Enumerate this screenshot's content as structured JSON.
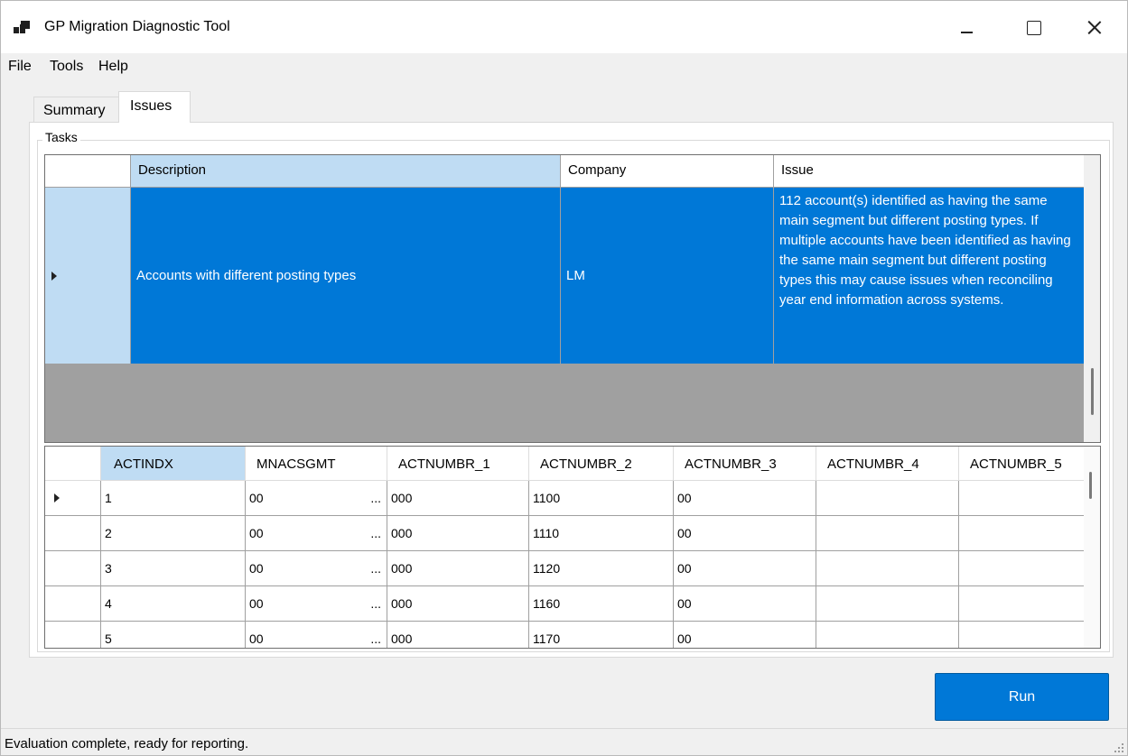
{
  "window": {
    "title": "GP Migration Diagnostic Tool"
  },
  "menu": {
    "file": "File",
    "tools": "Tools",
    "help": "Help"
  },
  "tabs": {
    "summary": "Summary",
    "issues": "Issues"
  },
  "group": {
    "label": "Tasks"
  },
  "tasks_grid": {
    "columns": [
      "Description",
      "Company",
      "Issue"
    ],
    "rows": [
      {
        "description": "Accounts with different posting types",
        "company": "LM",
        "issue": "112 account(s) identified as having the same main segment but different posting types. If multiple accounts have been identified as having the same main segment but different posting types this may cause issues when reconciling year end information across systems."
      }
    ]
  },
  "detail_grid": {
    "columns": [
      "ACTINDX",
      "MNACSGMT",
      "ACTNUMBR_1",
      "ACTNUMBR_2",
      "ACTNUMBR_3",
      "ACTNUMBR_4",
      "ACTNUMBR_5"
    ],
    "rows": [
      [
        "1",
        "00",
        "000",
        "1100",
        "00",
        "",
        ""
      ],
      [
        "2",
        "00",
        "000",
        "1110",
        "00",
        "",
        ""
      ],
      [
        "3",
        "00",
        "000",
        "1120",
        "00",
        "",
        ""
      ],
      [
        "4",
        "00",
        "000",
        "1160",
        "00",
        "",
        ""
      ],
      [
        "5",
        "00",
        "000",
        "1170",
        "00",
        "",
        ""
      ]
    ],
    "ellipsis": "..."
  },
  "buttons": {
    "run": "Run"
  },
  "status": {
    "text": "Evaluation complete, ready for reporting."
  },
  "colors": {
    "accent": "#0078d7",
    "header_selected": "#bfdcf3",
    "grid_background": "#a0a0a0"
  }
}
